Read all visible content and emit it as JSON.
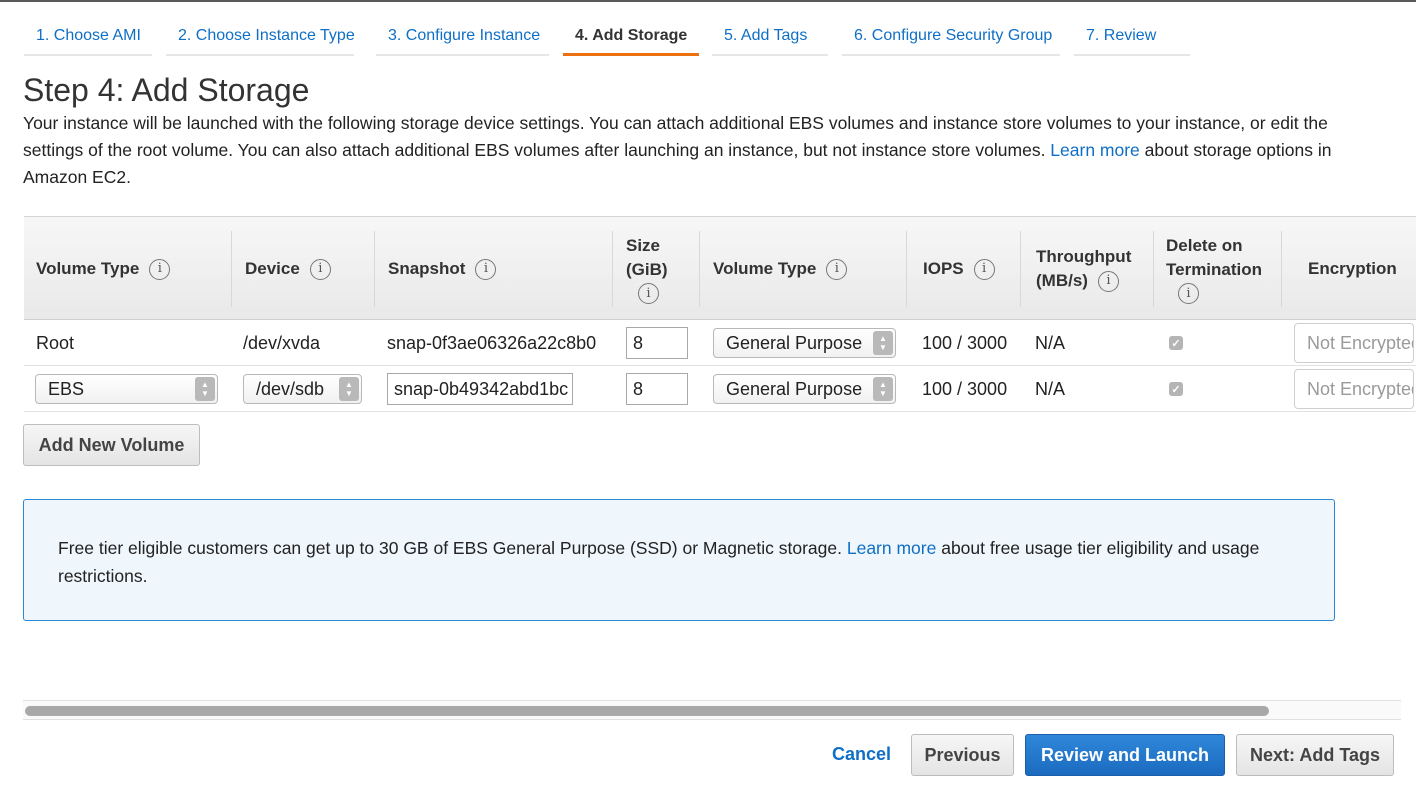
{
  "tabs": [
    {
      "label": "1. Choose AMI"
    },
    {
      "label": "2. Choose Instance Type"
    },
    {
      "label": "3. Configure Instance"
    },
    {
      "label": "4. Add Storage",
      "active": true
    },
    {
      "label": "5. Add Tags"
    },
    {
      "label": "6. Configure Security Group"
    },
    {
      "label": "7. Review"
    }
  ],
  "page": {
    "title": "Step 4: Add Storage",
    "desc_part1": "Your instance will be launched with the following storage device settings. You can attach additional EBS volumes and instance store volumes to your instance, or edit the settings of the root volume. You can also attach additional EBS volumes after launching an instance, but not instance store volumes. ",
    "desc_link": "Learn more",
    "desc_part2": " about storage options in Amazon EC2."
  },
  "table": {
    "headers": {
      "volume_type": "Volume Type",
      "device": "Device",
      "snapshot": "Snapshot",
      "size_line1": "Size",
      "size_line2": "(GiB)",
      "volume_type2": "Volume Type",
      "iops": "IOPS",
      "throughput_line1": "Throughput",
      "throughput_line2": "(MB/s)",
      "delete_line1": "Delete on",
      "delete_line2": "Termination",
      "encryption": "Encryption"
    },
    "rows": [
      {
        "volume_type": "Root",
        "device": "/dev/xvda",
        "snapshot": "snap-0f3ae06326a22c8b0",
        "size": "8",
        "volume_type2": "General Purpose",
        "iops": "100 / 3000",
        "throughput": "N/A",
        "delete_on_termination": true,
        "encryption": "Not Encrypted"
      },
      {
        "volume_type": "EBS",
        "device": "/dev/sdb",
        "snapshot": "snap-0b49342abd1bc",
        "size": "8",
        "volume_type2": "General Purpose",
        "iops": "100 / 3000",
        "throughput": "N/A",
        "delete_on_termination": true,
        "encryption": "Not Encrypted"
      }
    ]
  },
  "add_volume_label": "Add New Volume",
  "notice": {
    "text1": "Free tier eligible customers can get up to 30 GB of EBS General Purpose (SSD) or Magnetic storage. ",
    "link": "Learn more",
    "text2": " about free usage tier eligibility and usage restrictions."
  },
  "footer": {
    "cancel": "Cancel",
    "previous": "Previous",
    "review_launch": "Review and Launch",
    "next": "Next: Add Tags"
  },
  "icons": {
    "info": "info-icon",
    "check": "checkmark-icon",
    "select_arrows": "up-down-arrows-icon"
  },
  "colors": {
    "link": "#0f6fc6",
    "active_tab_underline": "#ec7211",
    "primary_button": "#1b6bc0",
    "notice_border": "#2b87d3",
    "notice_bg": "#eff6fc"
  }
}
